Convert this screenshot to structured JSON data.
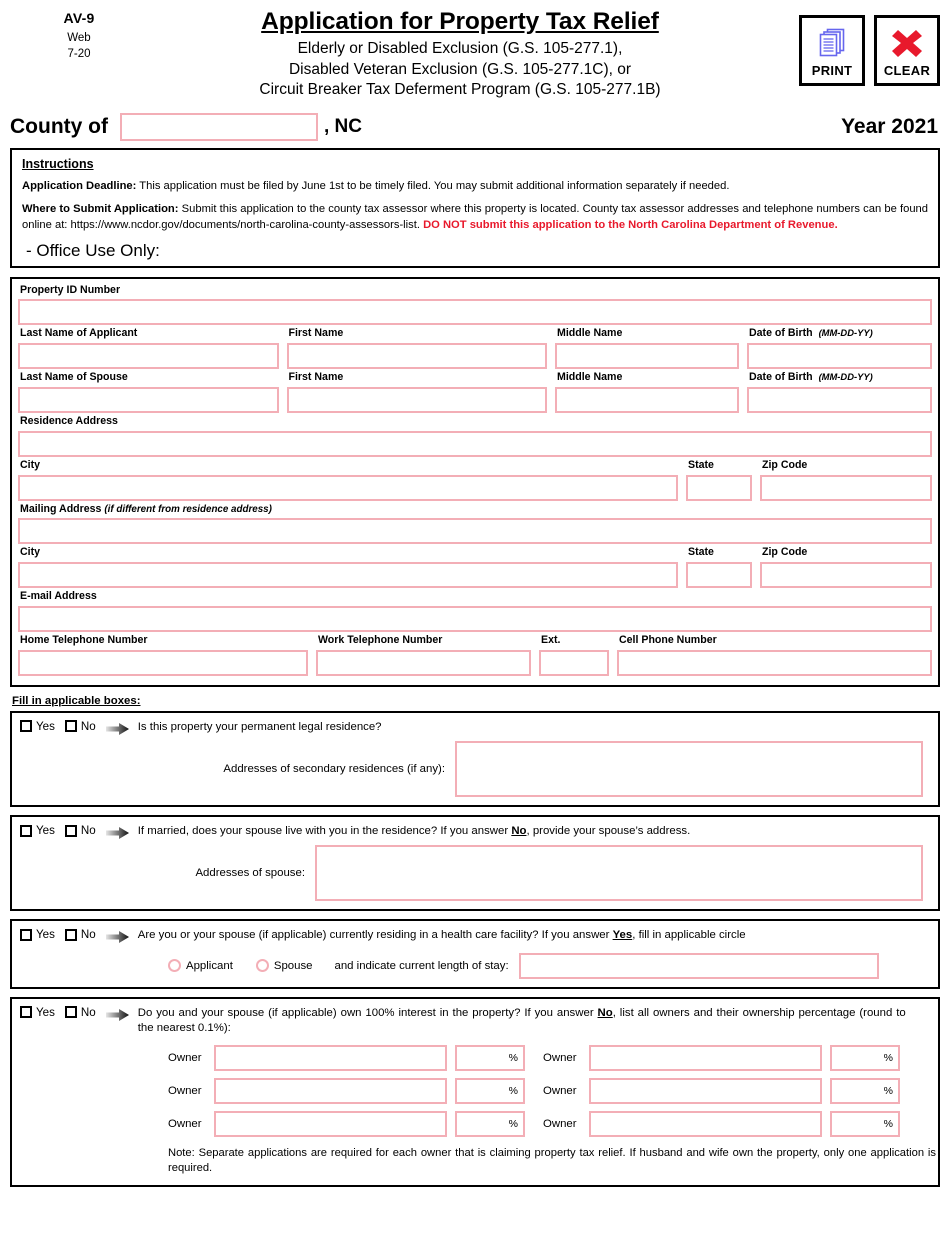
{
  "header": {
    "form_code": "AV-9",
    "form_web": "Web",
    "form_date": "7-20",
    "title": "Application for Property Tax Relief",
    "subtitle_line1": "Elderly or Disabled Exclusion (G.S. 105-277.1),",
    "subtitle_line2": "Disabled Veteran Exclusion (G.S. 105-277.1C), or",
    "subtitle_line3": "Circuit Breaker Tax Deferment Program (G.S. 105-277.1B)",
    "print_button": "PRINT",
    "clear_button": "CLEAR",
    "print_icon_color": "#6666ee",
    "clear_icon_color": "#e8192c"
  },
  "county_row": {
    "county_label": "County of",
    "county_value": "",
    "state_suffix": ", NC",
    "year_label": "Year 2021"
  },
  "instructions": {
    "heading": "Instructions",
    "deadline_label": "Application Deadline:",
    "deadline_text": "This application must be filed by June 1st to be timely filed.  You may submit additional information separately if needed.",
    "submit_label": "Where to Submit Application:",
    "submit_text": "Submit this application to the county tax assessor where this property is located.  County tax assessor addresses and telephone numbers can be found online at:  https://www.ncdor.gov/documents/north-carolina-county-assessors-list.",
    "submit_warning": "DO NOT submit this application to the North Carolina Department of Revenue.",
    "office_use": "- Office Use Only:"
  },
  "fields": {
    "property_id_label": "Property ID Number",
    "property_id_value": "",
    "applicant": {
      "last_label": "Last Name of Applicant",
      "first_label": "First Name",
      "middle_label": "Middle Name",
      "dob_label": "Date of Birth",
      "dob_hint": "(MM-DD-YY)",
      "last_value": "",
      "first_value": "",
      "middle_value": "",
      "dob_value": ""
    },
    "spouse": {
      "last_label": "Last Name of Spouse",
      "first_label": "First Name",
      "middle_label": "Middle Name",
      "dob_label": "Date of Birth",
      "dob_hint": "(MM-DD-YY)",
      "last_value": "",
      "first_value": "",
      "middle_value": "",
      "dob_value": ""
    },
    "residence_address_label": "Residence Address",
    "residence_address_value": "",
    "residence_city_label": "City",
    "residence_city_value": "",
    "residence_state_label": "State",
    "residence_state_value": "",
    "residence_zip_label": "Zip Code",
    "residence_zip_value": "",
    "mailing_address_label": "Mailing Address",
    "mailing_address_hint": "(if different from residence address)",
    "mailing_address_value": "",
    "mailing_city_label": "City",
    "mailing_city_value": "",
    "mailing_state_label": "State",
    "mailing_state_value": "",
    "mailing_zip_label": "Zip Code",
    "mailing_zip_value": "",
    "email_label": "E-mail Address",
    "email_value": "",
    "home_phone_label": "Home Telephone Number",
    "home_phone_value": "",
    "work_phone_label": "Work Telephone Number",
    "work_phone_value": "",
    "ext_label": "Ext.",
    "ext_value": "",
    "cell_phone_label": "Cell Phone Number",
    "cell_phone_value": ""
  },
  "questions_heading": "Fill in applicable boxes:",
  "yes_label": "Yes",
  "no_label": "No",
  "questions": [
    {
      "text_before": "Is this property your permanent legal residence?",
      "sub_label": "Addresses of secondary residences (if any):",
      "sub_value": ""
    },
    {
      "text_before": "If married, does your spouse live with you in the residence? If you answer ",
      "text_emph": "No",
      "text_after": ", provide your spouse’s address.",
      "sub_label": "Addresses of spouse:",
      "sub_value": ""
    },
    {
      "text_before": "Are you or your spouse (if applicable) currently residing in a health care facility?  If you answer ",
      "text_emph": "Yes",
      "text_after": ", fill in applicable circle",
      "radio_applicant": "Applicant",
      "radio_spouse": "Spouse",
      "stay_label": "and indicate current length of stay:",
      "stay_value": ""
    },
    {
      "text_before": "Do you and your spouse (if applicable) own 100% interest in the property?  If you answer ",
      "text_emph": "No",
      "text_after": ", list all owners and their ownership percentage (round to the nearest 0.1%):",
      "owner_label": "Owner",
      "percent_symbol": "%",
      "owners": [
        {
          "name": "",
          "pct": ""
        },
        {
          "name": "",
          "pct": ""
        },
        {
          "name": "",
          "pct": ""
        },
        {
          "name": "",
          "pct": ""
        },
        {
          "name": "",
          "pct": ""
        },
        {
          "name": "",
          "pct": ""
        }
      ],
      "note": "Note:  Separate applications are required for each owner that is claiming property tax relief.  If husband and wife own the property, only one application is required."
    }
  ],
  "colors": {
    "field_border": "#f3aeb6",
    "box_border": "#000000",
    "warning_red": "#e8192c"
  }
}
